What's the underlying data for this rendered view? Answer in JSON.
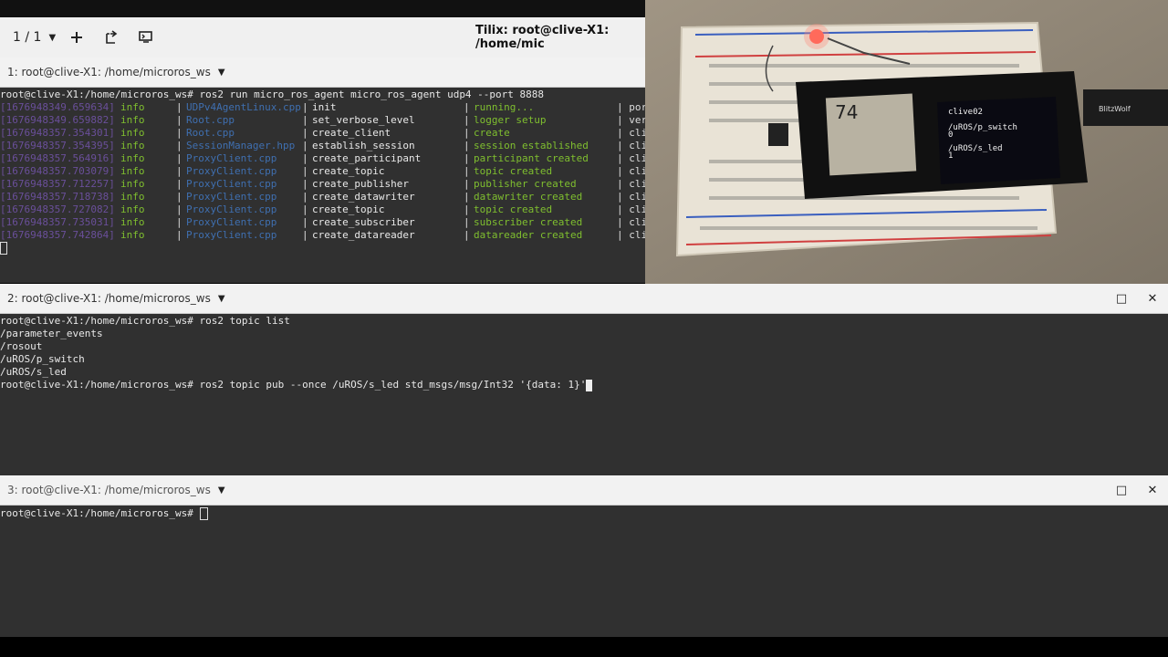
{
  "header": {
    "session_counter": "1 / 1",
    "window_title": "Tilix: root@clive-X1: /home/mic"
  },
  "pane1": {
    "title": "1: root@clive-X1: /home/microros_ws",
    "command_line": "root@clive-X1:/home/microros_ws# ros2 run micro_ros_agent micro_ros_agent udp4 --port 8888",
    "log_rows": [
      {
        "ts": "[1676948349.659634]",
        "level": "info",
        "file": "UDPv4AgentLinux.cpp",
        "fn": "init",
        "msg": "running...",
        "tail": "| por"
      },
      {
        "ts": "[1676948349.659882]",
        "level": "info",
        "file": "Root.cpp",
        "fn": "set_verbose_level",
        "msg": "logger setup",
        "tail": "| verb"
      },
      {
        "ts": "[1676948357.354301]",
        "level": "info",
        "file": "Root.cpp",
        "fn": "create_client",
        "msg": "create",
        "tail": "| clie"
      },
      {
        "ts": "[1676948357.354395]",
        "level": "info",
        "file": "SessionManager.hpp",
        "fn": "establish_session",
        "msg": "session established",
        "tail": "| clie"
      },
      {
        "ts": "[1676948357.564916]",
        "level": "info",
        "file": "ProxyClient.cpp",
        "fn": "create_participant",
        "msg": "participant created",
        "tail": "| clie"
      },
      {
        "ts": "[1676948357.703079]",
        "level": "info",
        "file": "ProxyClient.cpp",
        "fn": "create_topic",
        "msg": "topic created",
        "tail": "| clie"
      },
      {
        "ts": "[1676948357.712257]",
        "level": "info",
        "file": "ProxyClient.cpp",
        "fn": "create_publisher",
        "msg": "publisher created",
        "tail": "| clie"
      },
      {
        "ts": "[1676948357.718738]",
        "level": "info",
        "file": "ProxyClient.cpp",
        "fn": "create_datawriter",
        "msg": "datawriter created",
        "tail": "| clie"
      },
      {
        "ts": "[1676948357.727082]",
        "level": "info",
        "file": "ProxyClient.cpp",
        "fn": "create_topic",
        "msg": "topic created",
        "tail": "| clie"
      },
      {
        "ts": "[1676948357.735031]",
        "level": "info",
        "file": "ProxyClient.cpp",
        "fn": "create_subscriber",
        "msg": "subscriber created",
        "tail": "| clie"
      },
      {
        "ts": "[1676948357.742864]",
        "level": "info",
        "file": "ProxyClient.cpp",
        "fn": "create_datareader",
        "msg": "datareader created",
        "tail": "| clie"
      }
    ]
  },
  "pane2": {
    "title": "2: root@clive-X1: /home/microros_ws",
    "lines": [
      "root@clive-X1:/home/microros_ws# ros2 topic list",
      "/parameter_events",
      "/rosout",
      "/uROS/p_switch",
      "/uROS/s_led",
      "root@clive-X1:/home/microros_ws# ros2 topic pub --once /uROS/s_led std_msgs/msg/Int32 '{data: 1}'"
    ]
  },
  "pane3": {
    "title": "3: root@clive-X1: /home/microros_ws",
    "prompt": "root@clive-X1:/home/microros_ws# "
  },
  "photo": {
    "chip_marking": "74",
    "oled_lines": [
      "clive02",
      "/uROS/p_switch",
      "0",
      "/uROS/s_led",
      "1"
    ],
    "brand": "BlitzWolf"
  },
  "icons": {
    "maximize": "□",
    "close": "✕",
    "caret": "▼"
  },
  "colors": {
    "terminal_bg": "#303030",
    "timestamp": "#6a4f9a",
    "level": "#7fbf2f",
    "file": "#3f6fb0"
  }
}
